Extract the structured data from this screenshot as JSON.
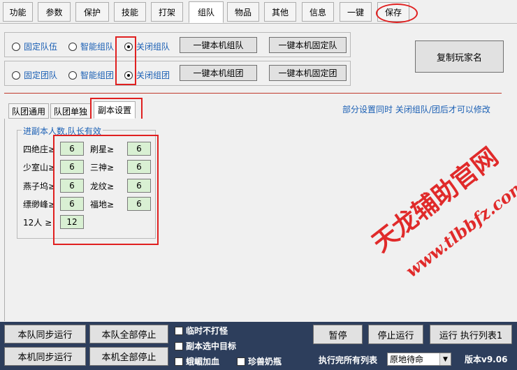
{
  "top_tabs": [
    {
      "label": "功能"
    },
    {
      "label": "参数"
    },
    {
      "label": "保护"
    },
    {
      "label": "技能"
    },
    {
      "label": "打架"
    },
    {
      "label": "组队"
    },
    {
      "label": "物品"
    },
    {
      "label": "其他"
    },
    {
      "label": "信息"
    },
    {
      "label": "一键"
    },
    {
      "label": "保存"
    }
  ],
  "team_row": {
    "radios": [
      "固定队伍",
      "智能组队",
      "关闭组队"
    ],
    "buttons": [
      "一键本机组队",
      "一键本机固定队"
    ]
  },
  "group_row": {
    "radios": [
      "固定团队",
      "智能组团",
      "关闭组团"
    ],
    "buttons": [
      "一键本机组团",
      "一键本机固定团"
    ]
  },
  "copy_player_button": "复制玩家名",
  "sub_tabs": [
    "队团通用",
    "队团单独",
    "副本设置"
  ],
  "notice": "部分设置同时 关闭组队/团后才可以修改",
  "dungeon_group": {
    "title": "进副本人数,队长有效",
    "left": [
      {
        "label": "四绝庄≥",
        "value": "6"
      },
      {
        "label": "少室山≥",
        "value": "6"
      },
      {
        "label": "燕子坞≥",
        "value": "6"
      },
      {
        "label": "缥缈峰≥",
        "value": "6"
      },
      {
        "label": "12人 ≥",
        "value": "12"
      }
    ],
    "right": [
      {
        "label": "刷星≥",
        "value": "6"
      },
      {
        "label": "三神≥",
        "value": "6"
      },
      {
        "label": "龙纹≥",
        "value": "6"
      },
      {
        "label": "福地≥",
        "value": "6"
      }
    ]
  },
  "watermark": {
    "line1": "天龙辅助官网",
    "line2": "www.tlbbfz.com"
  },
  "bottom": {
    "team_sync_run": "本队同步运行",
    "team_stop_all": "本队全部停止",
    "local_sync_run": "本机同步运行",
    "local_stop_all": "本机全部停止",
    "checks": [
      "临时不打怪",
      "副本选中目标",
      "蛾嵋加血",
      "珍兽奶瓶"
    ],
    "pause": "暂停",
    "stop_run": "停止运行",
    "run_list": "运行 执行列表1",
    "after_list_label": "执行完所有列表",
    "after_list_value": "原地待命",
    "version": "版本v9.06"
  }
}
